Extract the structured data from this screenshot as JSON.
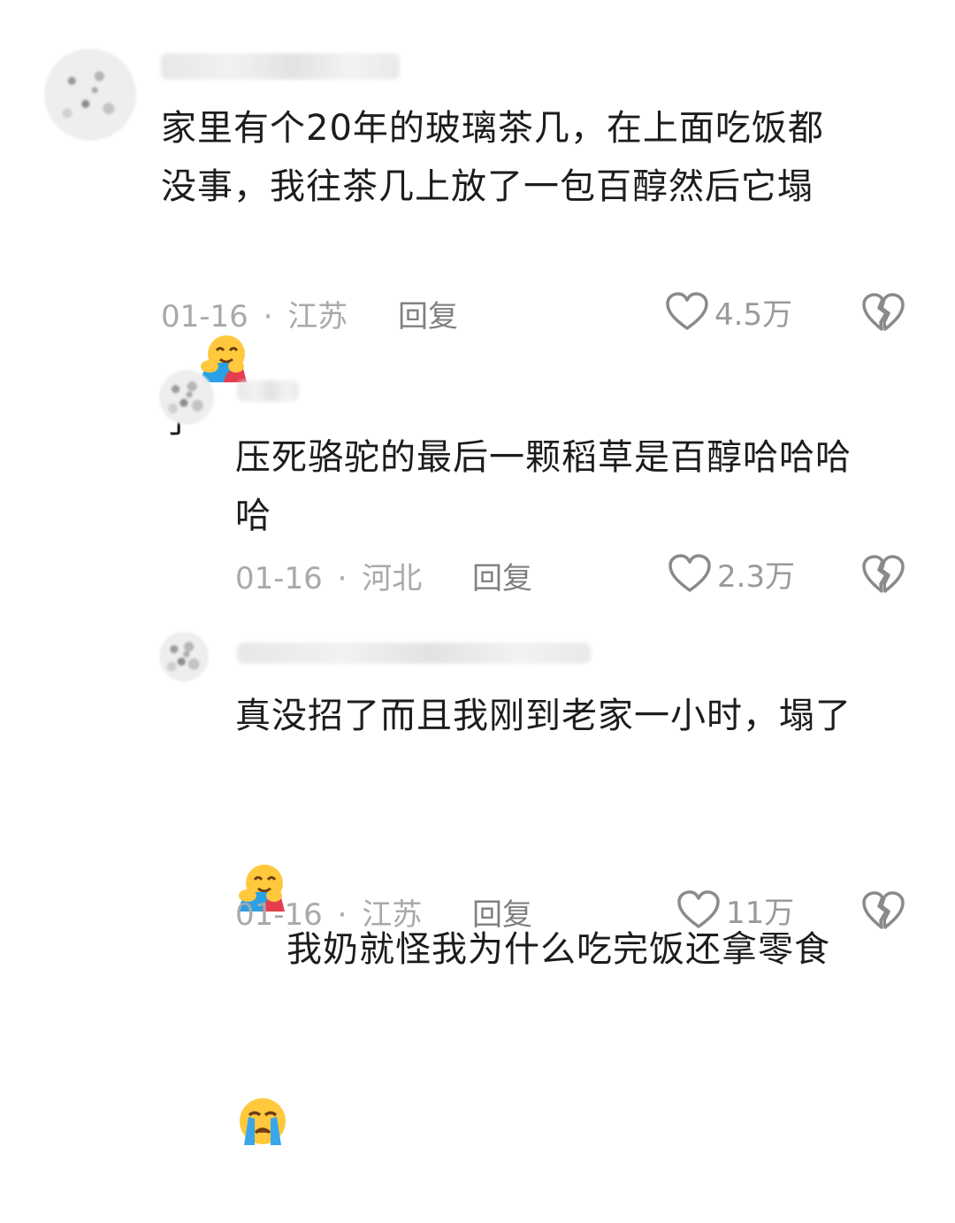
{
  "comments": [
    {
      "text_parts": [
        "家里有个20年的玻璃茶几，在上面吃饭都\n没事，我往茶几上放了一包百醇然后它塌\n了"
      ],
      "date": "01-16",
      "separator": "·",
      "location": "江苏",
      "reply_label": "回复",
      "likes": "4.5万",
      "emoji_1": "hugging-face-emoji"
    },
    {
      "text_parts": [
        "压死骆驼的最后一颗稻草是百醇哈哈哈\n哈"
      ],
      "date": "01-16",
      "separator": "·",
      "location": "河北",
      "reply_label": "回复",
      "likes": "2.3万"
    },
    {
      "text_parts": [
        "真没招了而且我刚到老家一小时，塌了\n",
        "我奶就怪我为什么吃完饭还拿零食\n"
      ],
      "date": "01-16",
      "separator": "·",
      "location": "江苏",
      "reply_label": "回复",
      "likes": "11万",
      "emoji_1": "hugging-face-emoji",
      "emoji_2": "loudly-crying-face-emoji"
    }
  ],
  "colors": {
    "text": "#1c1c1c",
    "meta": "#a9a9a9",
    "reply": "#808080",
    "icon": "#8a8a8a"
  }
}
